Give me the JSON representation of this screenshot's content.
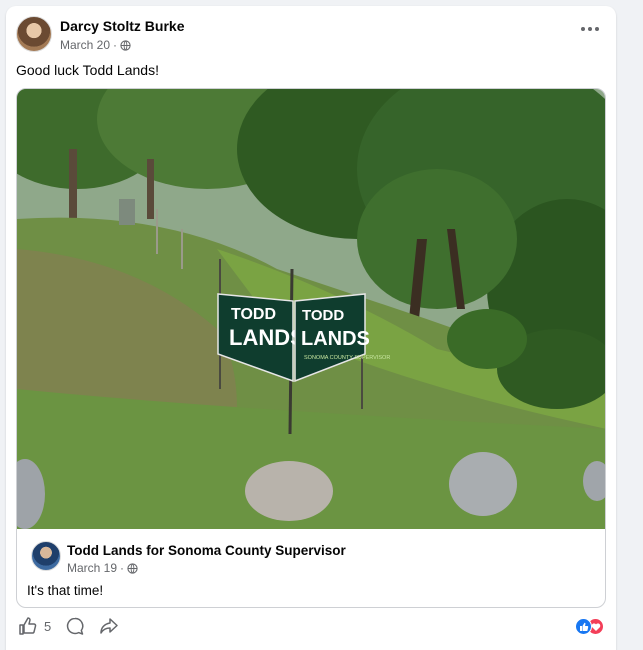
{
  "post": {
    "author": "Darcy Stoltz Burke",
    "date": "March 20",
    "privacy_icon": "globe-icon",
    "text": "Good luck Todd Lands!"
  },
  "shared_post": {
    "photo_sign_line1": "TODD",
    "photo_sign_line2": "LANDS",
    "photo_sign_line3": "SONOMA COUNTY SUPERVISOR",
    "author": "Todd Lands for Sonoma County Supervisor",
    "date": "March 19",
    "privacy_icon": "globe-icon",
    "text": "It's that time!"
  },
  "actions": {
    "like_count": "5",
    "like_icon": "thumbs-up-icon",
    "comment_icon": "comment-icon",
    "share_icon": "share-icon"
  },
  "reactions": [
    "like",
    "love"
  ],
  "colors": {
    "accent": "#1877f2",
    "love": "#f33e58",
    "secondary_text": "#65676b",
    "sign_green": "#0f3d2e"
  }
}
